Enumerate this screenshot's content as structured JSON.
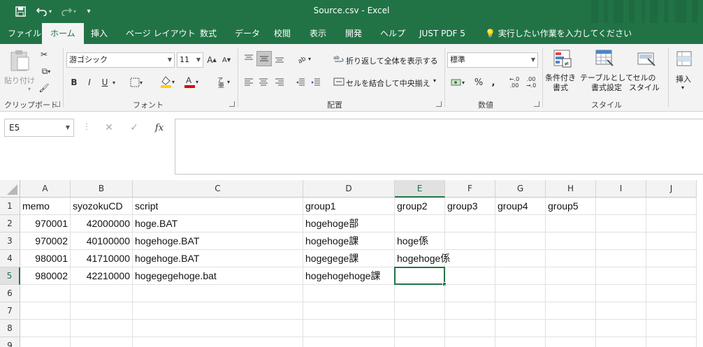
{
  "title_bar": {
    "doc_title": "Source.csv  -  Excel",
    "quick_access": [
      {
        "icon": "save-icon",
        "glyph": "💾"
      },
      {
        "icon": "undo-icon",
        "glyph": "↶"
      },
      {
        "icon": "redo-icon",
        "glyph": "↷"
      },
      {
        "icon": "customize-icon",
        "glyph": "▾"
      }
    ]
  },
  "tabs": [
    "ファイル",
    "ホーム",
    "挿入",
    "ページ レイアウト",
    "数式",
    "データ",
    "校閲",
    "表示",
    "開発",
    "ヘルプ",
    "JUST PDF 5",
    "実行したい作業を入力してください"
  ],
  "active_tab": "ホーム",
  "ribbon": {
    "clipboard": {
      "paste": "貼り付け",
      "label": "クリップボード"
    },
    "font": {
      "name": "游ゴシック",
      "size": "11",
      "bold": "B",
      "italic": "I",
      "underline": "U",
      "label": "フォント"
    },
    "alignment": {
      "wrap": "折り返して全体を表示する",
      "merge": "セルを結合して中央揃え",
      "label": "配置"
    },
    "number": {
      "format": "標準",
      "percent": "%",
      "comma": ",",
      "label": "数値"
    },
    "styles": {
      "conditional": "条件付き\n書式",
      "table": "テーブルとして\n書式設定",
      "cell": "セルの\nスタイル",
      "label": "スタイル"
    },
    "cells": {
      "insert": "挿入"
    }
  },
  "formula_bar": {
    "name_box": "E5",
    "fx": "fx",
    "value": ""
  },
  "grid": {
    "columns": [
      "A",
      "B",
      "C",
      "D",
      "E",
      "F",
      "G",
      "H",
      "I",
      "J"
    ],
    "selected_column": "E",
    "rows": [
      "1",
      "2",
      "3",
      "4",
      "5",
      "6",
      "7",
      "8",
      "9"
    ],
    "selected_row": "5",
    "cells": [
      [
        "memo",
        "syozokuCD",
        "script",
        "group1",
        "group2",
        "group3",
        "group4",
        "group5",
        "",
        ""
      ],
      [
        "970001",
        "42000000",
        "hoge.BAT",
        "hogehoge部",
        "",
        "",
        "",
        "",
        "",
        ""
      ],
      [
        "970002",
        "40100000",
        "hogehoge.BAT",
        "hogehoge課",
        "hoge係",
        "",
        "",
        "",
        "",
        ""
      ],
      [
        "980001",
        "41710000",
        "hogehoge.BAT",
        "hogegege課",
        "hogehoge係",
        "",
        "",
        "",
        "",
        ""
      ],
      [
        "980002",
        "42210000",
        "hogegegehoge.bat",
        "hogehogehoge課",
        "",
        "",
        "",
        "",
        "",
        ""
      ],
      [
        "",
        "",
        "",
        "",
        "",
        "",
        "",
        "",
        "",
        ""
      ],
      [
        "",
        "",
        "",
        "",
        "",
        "",
        "",
        "",
        "",
        ""
      ],
      [
        "",
        "",
        "",
        "",
        "",
        "",
        "",
        "",
        "",
        ""
      ],
      [
        "",
        "",
        "",
        "",
        "",
        "",
        "",
        "",
        "",
        ""
      ]
    ],
    "numeric_columns": [
      0,
      1
    ]
  },
  "colors": {
    "accent": "#217346",
    "ribbon_bg": "#f3f3f3"
  }
}
